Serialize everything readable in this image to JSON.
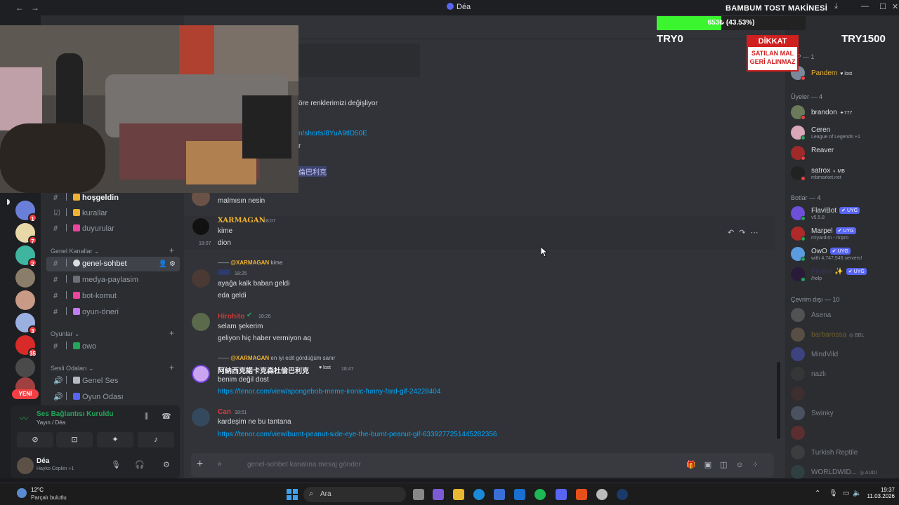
{
  "window": {
    "title": "Déa",
    "nav_back": "←",
    "nav_fwd": "→",
    "minimize": "—",
    "maximize": "☐",
    "close": "✕"
  },
  "overlay": {
    "title": "BAMBUM TOST MAKİNESİ",
    "progress_text": "653₺ (43.53%)",
    "progress_fraction": 0.4353,
    "left_label": "TRY0",
    "right_label": "TRY1500",
    "warning_head": "DİKKAT",
    "warning_line1": "SATILAN MAL",
    "warning_line2": "GERİ ALINMAZ"
  },
  "rail": {
    "new_label": "YENİ",
    "badges": [
      "1",
      "7",
      "2",
      "3",
      "35"
    ]
  },
  "channels": {
    "items": [
      {
        "name": "hoşgeldin",
        "color": "#f0b232",
        "bold": true
      },
      {
        "name": "kurallar",
        "color": "#f0b232"
      },
      {
        "name": "duyurular",
        "color": "#eb459e"
      }
    ],
    "cat_general": "Genel Kanallar",
    "general": [
      {
        "name": "genel-sohbet",
        "color": "#dbdee1",
        "active": true
      },
      {
        "name": "medya-paylasim",
        "color": "#b5bac1"
      },
      {
        "name": "bot-komut",
        "color": "#eb459e"
      },
      {
        "name": "oyun-öneri",
        "color": "#c27cf3"
      }
    ],
    "cat_games": "Oyunlar",
    "games": [
      {
        "name": "owo",
        "color": "#23a55a"
      }
    ],
    "cat_voice": "Sesli Odaları",
    "voice": [
      {
        "name": "Genel Ses",
        "color": "#b5bac1"
      },
      {
        "name": "Oyun Odası",
        "color": "#5865f2"
      }
    ]
  },
  "voice_panel": {
    "title": "Ses Bağlantısı Kuruldu",
    "subtitle": "Yayın / Déa"
  },
  "user_panel": {
    "name": "Déa",
    "status": "Hayko Cepkin +1"
  },
  "messages": {
    "partial1": "öre renklerimizi değişliyor",
    "partial2": "n/shorts/8YuA9tlD50E",
    "partial3": "r",
    "partial4": "倫巴利克",
    "m0": "malmısın nesin",
    "m1_author": "XARMAGAN",
    "m1_time": "18:07",
    "m1_l1": "kime",
    "m1_l2": "dion",
    "m1_side_time": "18:07",
    "m2_reply_author": "@XARMAGAN",
    "m2_reply_text": "kime",
    "m2_time": "18:25",
    "m2_l1": "ayağa kalk baban geldi",
    "m2_l2": "eda geldi",
    "m3_author": "Hirohito",
    "m3_time": "18:26",
    "m3_l1": "selam şekerim",
    "m3_l2": "geliyon hiç haber vermiyon aq",
    "m4_reply_author": "@XARMAGAN",
    "m4_reply_text": "en iyi edit gördüğüm sanır",
    "m4_author": "阿納西克諾卡克森杜倫巴利克",
    "m4_tag": "lost",
    "m4_time": "18:47",
    "m4_l1": "benim değil dost",
    "m4_link": "https://tenor.com/view/spongebob-meme-ironic-funny-fard-gif-24228404",
    "m5_author": "Can",
    "m5_time": "18:51",
    "m5_l1": "kardeşim ne bu tantana",
    "m5_link": "https://tenor.com/view/burnt-peanut-side-eye-the-burnt-peanut-gif-6339277251445282356",
    "composer_placeholder": "genel-sohbet kanalına mesaj gönder"
  },
  "members": {
    "vip_cat": "VIP — 1",
    "vip": [
      {
        "name": "Pandem",
        "extra": "lost",
        "color": "#f0b232"
      }
    ],
    "users_cat": "Üyeler — 4",
    "users": [
      {
        "name": "brandon",
        "extra": "777",
        "sub": ""
      },
      {
        "name": "Ceren",
        "extra": "",
        "sub": "League of Legends +1"
      },
      {
        "name": "Reaver",
        "extra": "",
        "sub": ""
      },
      {
        "name": "satrox",
        "extra": "MB",
        "sub": "mbmarket.net"
      }
    ],
    "bots_cat": "Botlar — 4",
    "bots": [
      {
        "name": "FlaviBot",
        "badge": "UYG",
        "sub": "v5.5.8"
      },
      {
        "name": "Marpel",
        "badge": "UYG",
        "sub": "m!yardım - m!pro"
      },
      {
        "name": "OwO",
        "badge": "UYG",
        "sub": "with 4,747,545 servers!"
      },
      {
        "name": "ProBot ✨",
        "badge": "UYG",
        "sub": "/help"
      }
    ],
    "offline_cat": "Çevrim dışı — 10",
    "offline": [
      {
        "name": "Asena"
      },
      {
        "name": "barbarossa",
        "extra": "BBL"
      },
      {
        "name": "MindVild"
      },
      {
        "name": "nazlı"
      },
      {
        "name": ""
      },
      {
        "name": "Swinky"
      },
      {
        "name": ""
      },
      {
        "name": "Turkish Reptile"
      },
      {
        "name": "WORLDWID...",
        "extra": "AUDI"
      }
    ]
  },
  "taskbar": {
    "weather_temp": "12°C",
    "weather_desc": "Parçalı bulutlu",
    "search_label": "Ara",
    "time": "19:37",
    "date": "11.03.2026"
  }
}
